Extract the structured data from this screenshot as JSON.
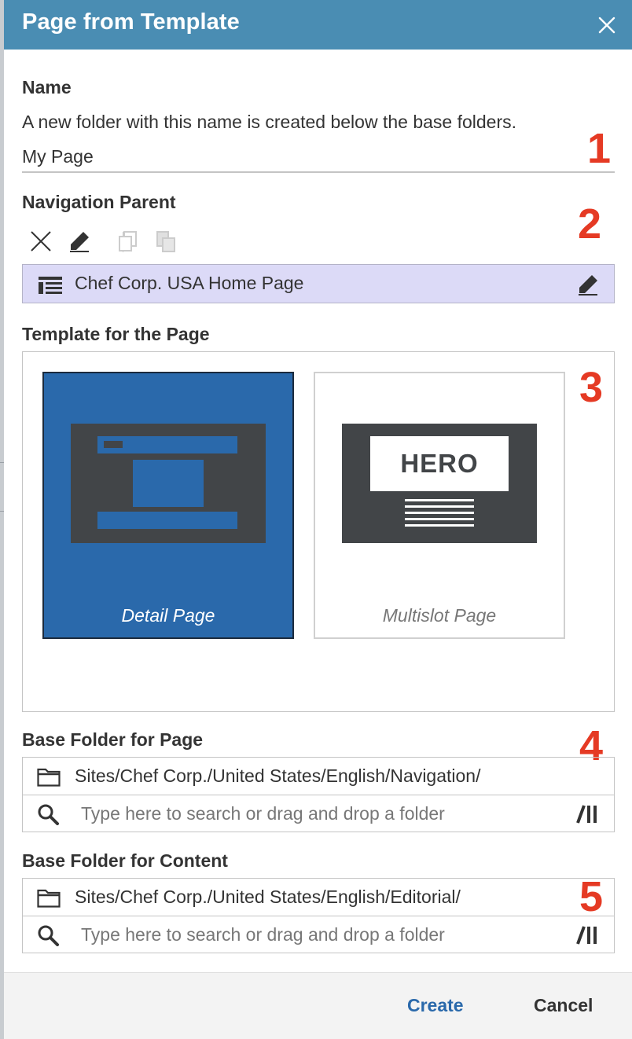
{
  "dialog": {
    "title": "Page from Template",
    "close_icon": "close-icon"
  },
  "name_section": {
    "label": "Name",
    "help": "A new folder with this name is created below the base folders.",
    "value": "My Page"
  },
  "navigation_parent": {
    "label": "Navigation Parent",
    "toolbar": [
      "remove-icon",
      "edit-icon",
      "copy-icon",
      "paste-icon"
    ],
    "value": "Chef Corp. USA Home Page",
    "item_icon": "page-icon",
    "edit_icon": "edit-icon"
  },
  "template_section": {
    "label": "Template for the Page",
    "templates": [
      {
        "label": "Detail Page",
        "selected": true
      },
      {
        "label": "Multislot Page",
        "selected": false,
        "thumb_text": "HERO"
      }
    ]
  },
  "base_folder_page": {
    "label": "Base Folder for Page",
    "path": "Sites/Chef Corp./United States/English/Navigation/",
    "search_placeholder": "Type here to search or drag and drop a folder"
  },
  "base_folder_content": {
    "label": "Base Folder for Content",
    "path": "Sites/Chef Corp./United States/English/Editorial/",
    "search_placeholder": "Type here to search or drag and drop a folder"
  },
  "annotations": [
    "1",
    "2",
    "3",
    "4",
    "5"
  ],
  "footer": {
    "create_label": "Create",
    "cancel_label": "Cancel"
  },
  "colors": {
    "header": "#4a8db3",
    "accent": "#2a69ab",
    "selection": "#dcdaf7",
    "annotation": "#e53a24"
  }
}
